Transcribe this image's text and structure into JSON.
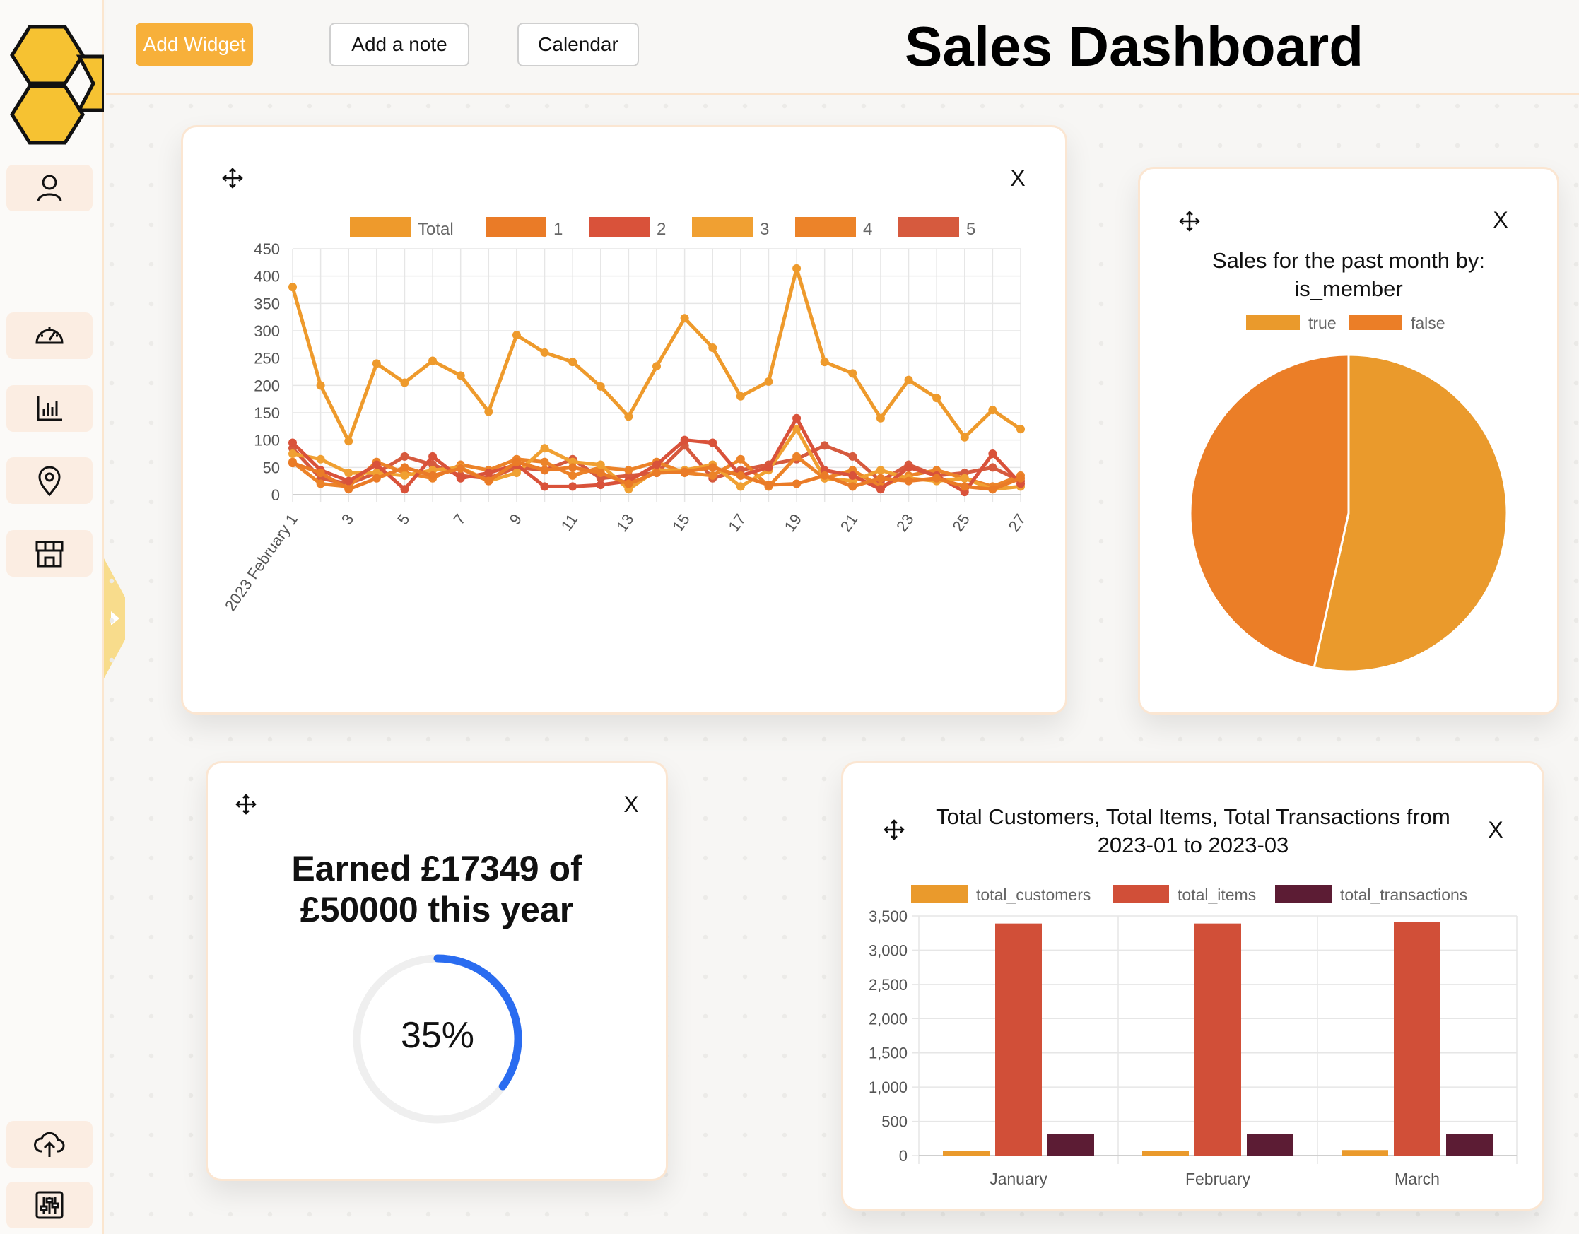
{
  "app": {
    "title": "Sales Dashboard"
  },
  "toolbar": {
    "add_widget": "Add Widget",
    "add_note": "Add a note",
    "calendar": "Calendar"
  },
  "sidebar": {
    "items": [
      {
        "name": "user-icon"
      },
      {
        "name": "dashboard-gauge-icon"
      },
      {
        "name": "bar-chart-icon"
      },
      {
        "name": "location-pin-icon"
      },
      {
        "name": "store-icon"
      },
      {
        "name": "cloud-upload-icon"
      },
      {
        "name": "settings-sliders-icon"
      }
    ]
  },
  "colors": {
    "accent": "#f7b03a",
    "honey": "#f6c232",
    "total": "#ee9a2c",
    "s1": "#ea7b27",
    "s2": "#d9523a",
    "s3": "#f0a032",
    "s4": "#ec8329",
    "s5": "#d65a3e",
    "bar_items": "#d14f38",
    "bar_tx": "#5c1c34",
    "progress": "#2a6cf0"
  },
  "widgets": {
    "line": {
      "close": "X"
    },
    "pie": {
      "title_line1": "Sales for the past month by:",
      "title_line2": "is_member",
      "close": "X"
    },
    "progress": {
      "title_line1": "Earned £17349 of",
      "title_line2": "£50000 this year",
      "label": "35%",
      "close": "X"
    },
    "bar": {
      "title_line1": "Total Customers, Total Items, Total Transactions from",
      "title_line2": "2023-01 to 2023-03",
      "close": "X"
    }
  },
  "chart_data": [
    {
      "type": "line",
      "x": [
        "2023 February 1",
        "2",
        "3",
        "4",
        "5",
        "6",
        "7",
        "8",
        "9",
        "10",
        "11",
        "12",
        "13",
        "14",
        "15",
        "16",
        "17",
        "18",
        "19",
        "20",
        "21",
        "22",
        "23",
        "24",
        "25",
        "26",
        "27"
      ],
      "tick_labels": [
        "2023 February 1",
        "3",
        "5",
        "7",
        "9",
        "11",
        "13",
        "15",
        "17",
        "19",
        "21",
        "23",
        "25",
        "27"
      ],
      "ylim": [
        0,
        450
      ],
      "yticks": [
        0,
        50,
        100,
        150,
        200,
        250,
        300,
        350,
        400,
        450
      ],
      "grid": true,
      "legend": "top",
      "series": [
        {
          "name": "Total",
          "color": "#ee9a2c",
          "values": [
            380,
            200,
            98,
            240,
            205,
            245,
            218,
            152,
            292,
            260,
            243,
            198,
            143,
            235,
            323,
            269,
            180,
            207,
            414,
            243,
            222,
            140,
            210,
            177,
            105,
            155,
            120
          ]
        },
        {
          "name": "1",
          "color": "#ea7b27",
          "values": [
            58,
            40,
            10,
            30,
            50,
            35,
            48,
            25,
            60,
            45,
            50,
            40,
            20,
            40,
            42,
            50,
            35,
            18,
            20,
            35,
            15,
            30,
            25,
            30,
            15,
            10,
            30
          ]
        },
        {
          "name": "2",
          "color": "#d9523a",
          "values": [
            95,
            45,
            25,
            55,
            10,
            70,
            30,
            40,
            55,
            15,
            15,
            18,
            25,
            55,
            100,
            95,
            35,
            50,
            140,
            45,
            35,
            10,
            50,
            35,
            5,
            75,
            20
          ]
        },
        {
          "name": "3",
          "color": "#f0a032",
          "values": [
            75,
            65,
            40,
            40,
            35,
            45,
            50,
            25,
            40,
            85,
            60,
            55,
            10,
            45,
            45,
            55,
            15,
            45,
            120,
            30,
            25,
            45,
            30,
            25,
            30,
            10,
            15
          ]
        },
        {
          "name": "4",
          "color": "#ec8329",
          "values": [
            60,
            20,
            15,
            60,
            40,
            30,
            55,
            45,
            65,
            60,
            35,
            50,
            45,
            60,
            40,
            35,
            65,
            15,
            70,
            30,
            45,
            15,
            35,
            45,
            30,
            15,
            35
          ]
        },
        {
          "name": "5",
          "color": "#d65a3e",
          "values": [
            85,
            30,
            20,
            40,
            70,
            55,
            35,
            30,
            50,
            45,
            65,
            30,
            35,
            40,
            90,
            30,
            45,
            55,
            65,
            90,
            70,
            25,
            55,
            35,
            40,
            50,
            25
          ]
        }
      ]
    },
    {
      "type": "pie",
      "title": "Sales for the past month by: is_member",
      "legend": "top",
      "labels": [
        "true",
        "false"
      ],
      "values": [
        53.5,
        46.5
      ],
      "colors": [
        "#ea9a2c",
        "#eb7e27"
      ]
    },
    {
      "type": "bar",
      "title": "Total Customers, Total Items, Total Transactions from 2023-01 to 2023-03",
      "categories": [
        "January",
        "February",
        "March"
      ],
      "ylim": [
        0,
        3500
      ],
      "yticks": [
        "0",
        "500",
        "1,000",
        "1,500",
        "2,000",
        "2,500",
        "3,000",
        "3,500"
      ],
      "legend": "top",
      "series": [
        {
          "name": "total_customers",
          "color": "#ea9a2c",
          "values": [
            70,
            70,
            80
          ]
        },
        {
          "name": "total_items",
          "color": "#d14f38",
          "values": [
            3390,
            3390,
            3410
          ]
        },
        {
          "name": "total_transactions",
          "color": "#5c1c34",
          "values": [
            310,
            310,
            320
          ]
        }
      ]
    },
    {
      "type": "progress",
      "value": 0.35
    }
  ]
}
